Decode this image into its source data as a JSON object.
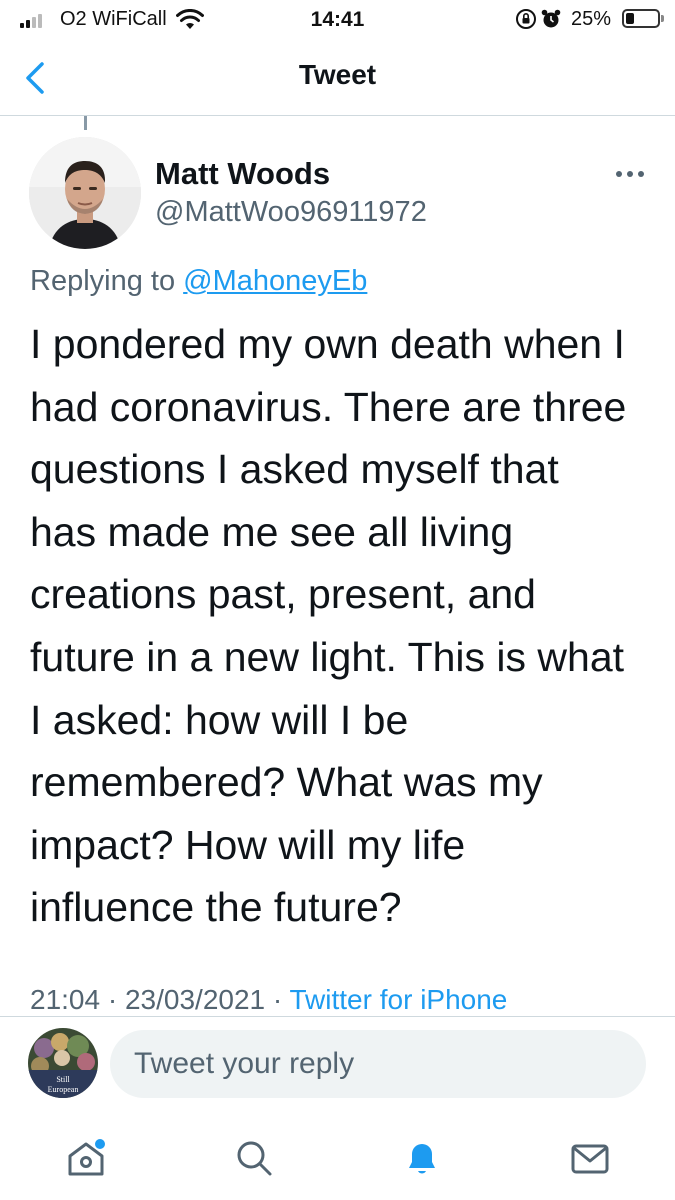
{
  "status_bar": {
    "carrier": "O2 WiFiCall",
    "time": "14:41",
    "battery_percent": "25%",
    "battery_level": 0.25
  },
  "nav": {
    "title": "Tweet"
  },
  "tweet": {
    "author_name": "Matt Woods",
    "author_handle": "@MattWoo96911972",
    "replying_prefix": "Replying to ",
    "replying_to": "@MahoneyEb",
    "body_lines": [
      "I pondered my own death when I",
      "had coronavirus. There are three",
      "questions I asked myself that",
      "has made me see all living",
      "creations past, present, and",
      "future in a new light. This is what",
      "I asked: how will I be",
      "remembered? What was my",
      "impact? How will my life",
      "influence the future?"
    ],
    "time": "21:04",
    "date": "23/03/2021",
    "separator": " · ",
    "source": "Twitter for iPhone"
  },
  "reply": {
    "placeholder": "Tweet your reply",
    "avatar_text": [
      "Still",
      "European"
    ]
  },
  "colors": {
    "accent": "#1d9bf0",
    "secondary_text": "#536471",
    "primary_text": "#0f1419"
  },
  "tabs": [
    {
      "name": "home",
      "icon": "home-icon",
      "has_notification_dot": true
    },
    {
      "name": "search",
      "icon": "search-icon",
      "has_notification_dot": false
    },
    {
      "name": "notifications",
      "icon": "bell-icon",
      "active": true
    },
    {
      "name": "messages",
      "icon": "mail-icon",
      "has_notification_dot": false
    }
  ]
}
